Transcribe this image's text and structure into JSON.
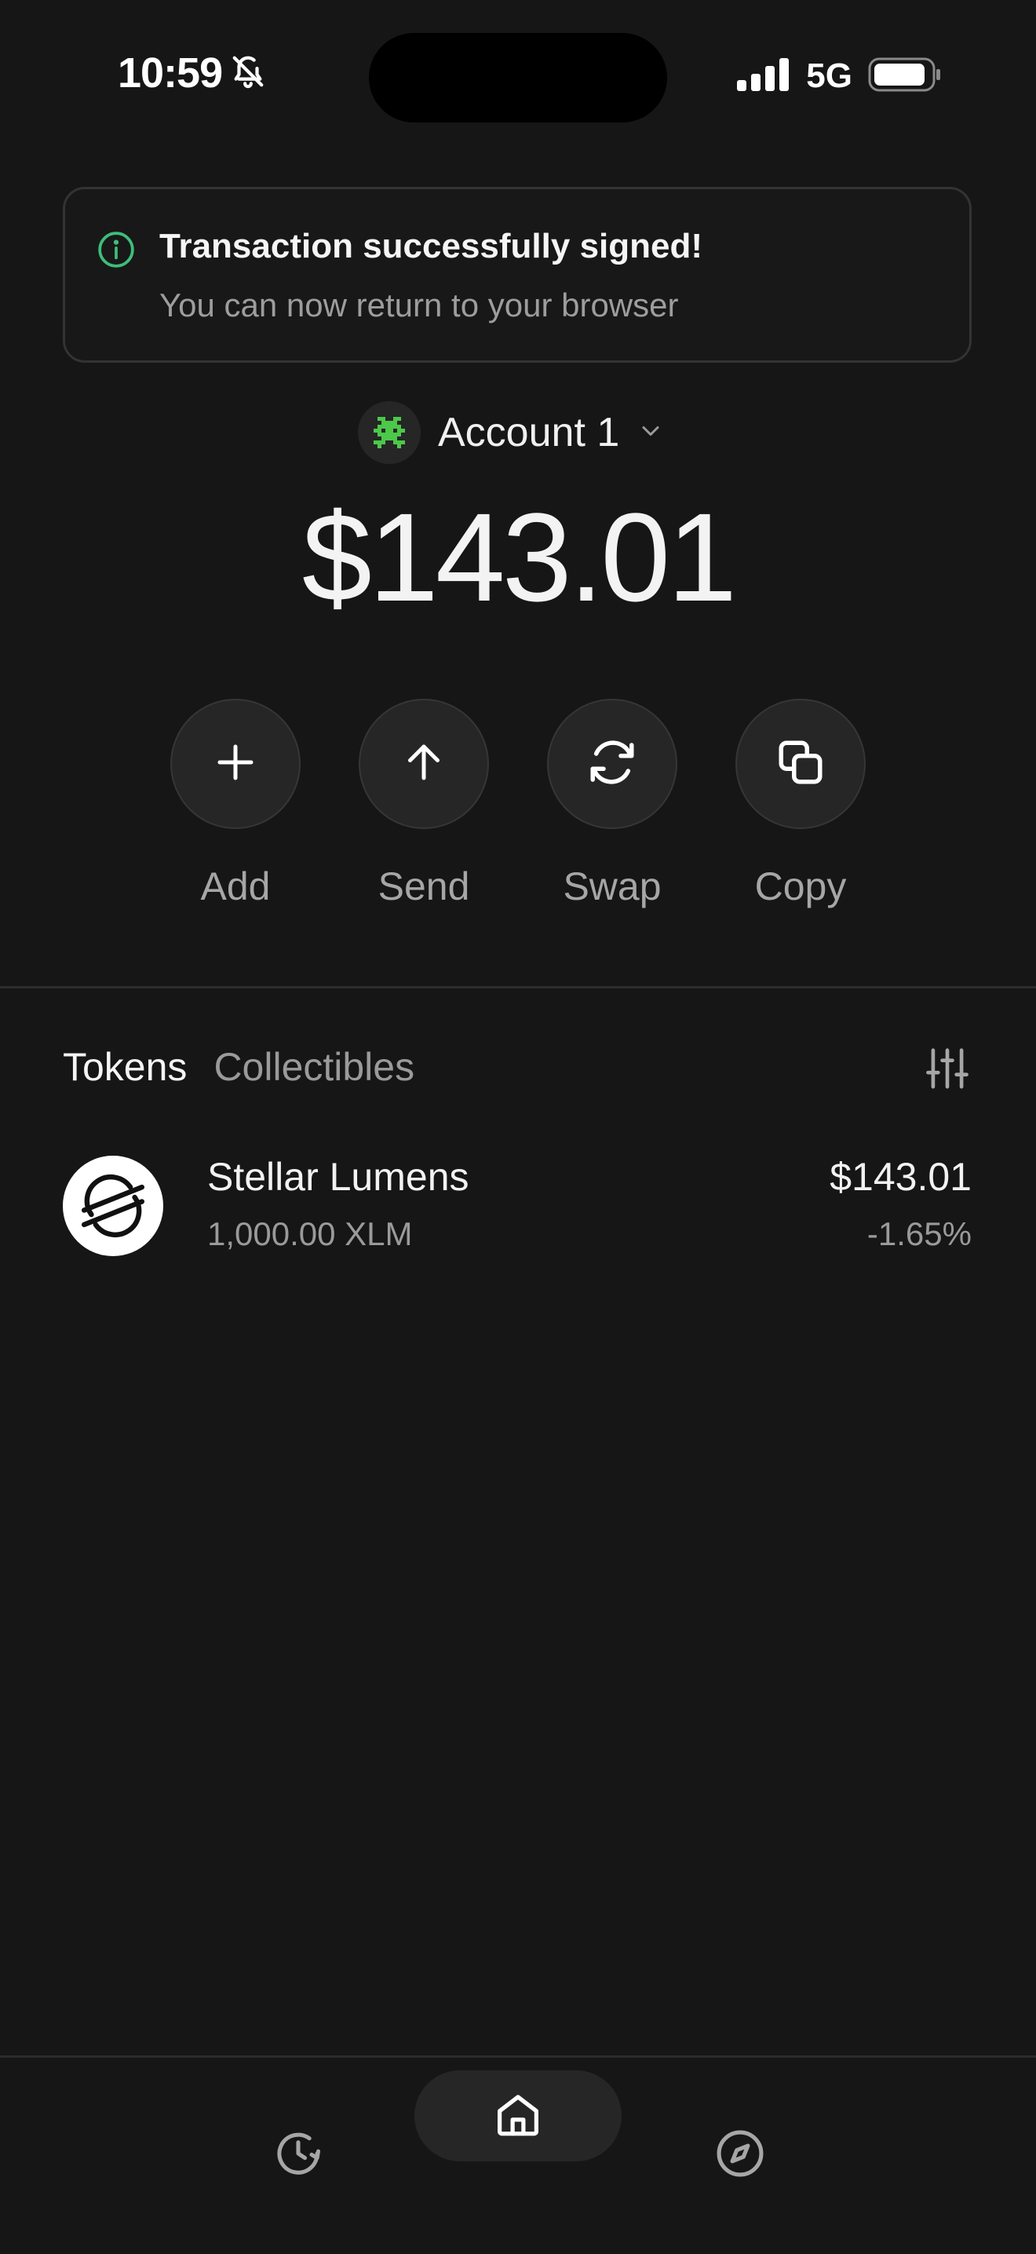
{
  "status_bar": {
    "time": "10:59",
    "network": "5G",
    "icons": [
      "bell-slash-icon",
      "signal-bars-icon",
      "battery-icon"
    ]
  },
  "toast": {
    "icon": "info-circle-icon",
    "title": "Transaction successfully signed!",
    "subtitle": "You can now return to your browser",
    "accent_color": "#3dbe7a"
  },
  "account": {
    "name": "Account 1",
    "avatar_icon": "pixel-avatar-icon",
    "avatar_color": "#4cc84a"
  },
  "balance": "$143.01",
  "actions": [
    {
      "label": "Add",
      "icon": "plus-icon"
    },
    {
      "label": "Send",
      "icon": "arrow-up-icon"
    },
    {
      "label": "Swap",
      "icon": "refresh-icon"
    },
    {
      "label": "Copy",
      "icon": "copy-icon"
    }
  ],
  "tabs": [
    {
      "label": "Tokens",
      "active": true
    },
    {
      "label": "Collectibles",
      "active": false
    }
  ],
  "filter_icon": "sliders-icon",
  "tokens": [
    {
      "name": "Stellar Lumens",
      "amount": "1,000.00 XLM",
      "value": "$143.01",
      "change": "-1.65%",
      "icon": "stellar-logo-icon"
    }
  ],
  "bottom_nav": [
    {
      "name": "history",
      "icon": "clock-history-icon",
      "active": false
    },
    {
      "name": "home",
      "icon": "home-icon",
      "active": true
    },
    {
      "name": "discover",
      "icon": "compass-icon",
      "active": false
    }
  ]
}
